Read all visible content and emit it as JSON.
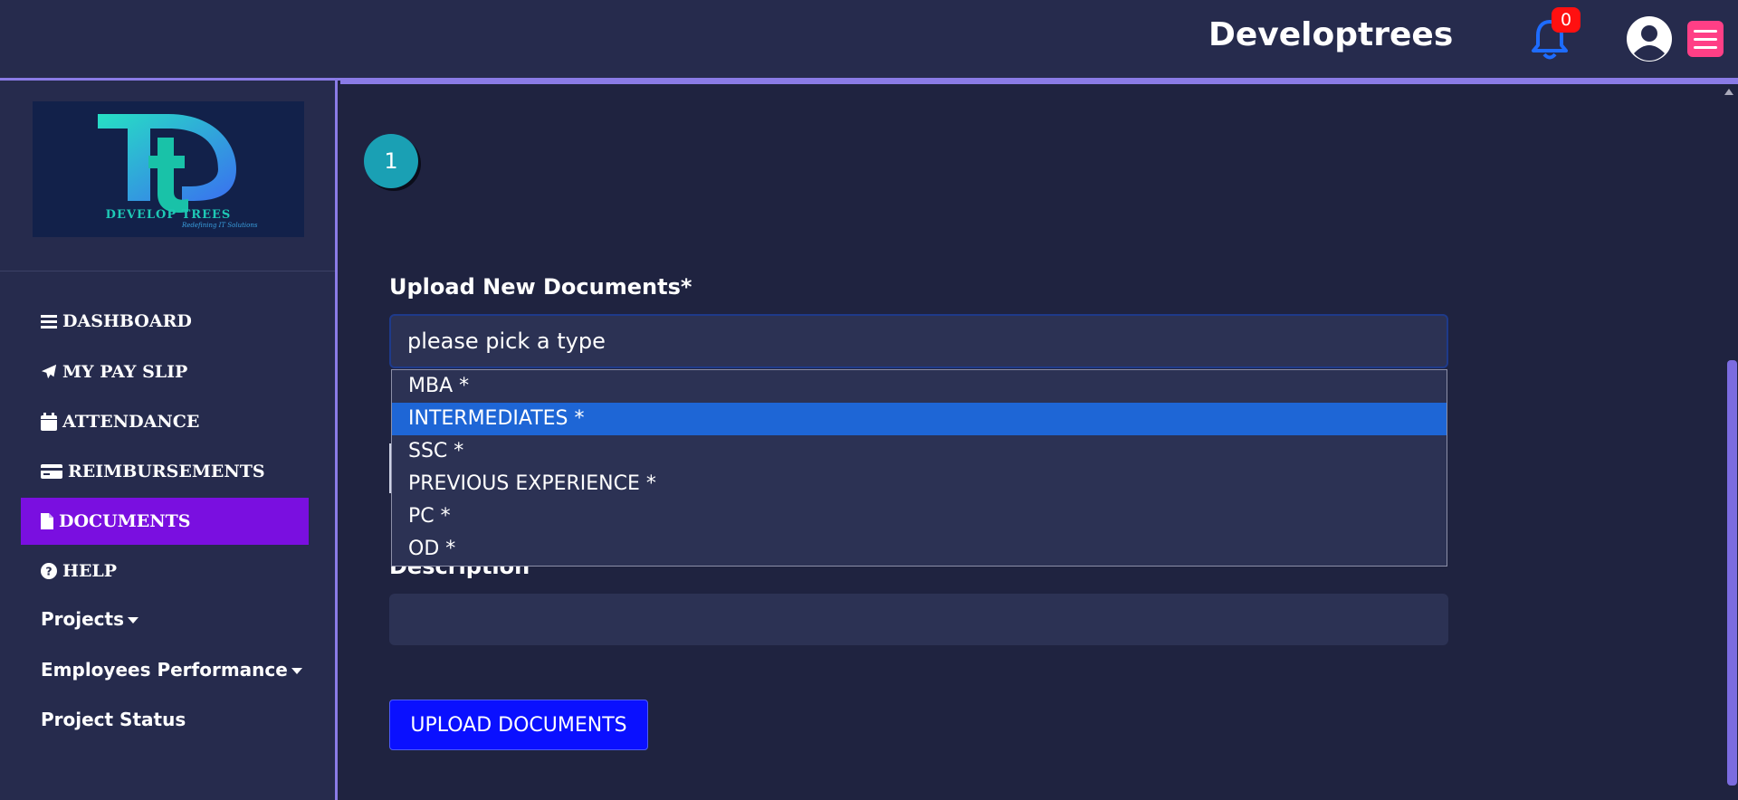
{
  "header": {
    "app_title": "Developtrees",
    "notification_count": "0",
    "bell_icon": "bell-icon",
    "user_icon": "user-circle-icon",
    "menu_icon": "hamburger-menu-icon",
    "accent_color": "#8a7be6",
    "menu_button_color": "#ff3f86"
  },
  "sidebar": {
    "logo": {
      "company": "DEVELOP TREES",
      "tagline": "Redefining IT Solutions",
      "monogram": "Dt"
    },
    "items": [
      {
        "label": "DASHBOARD",
        "icon": "bars-icon",
        "active": false
      },
      {
        "label": "MY PAY SLIP",
        "icon": "paper-plane-icon",
        "active": false
      },
      {
        "label": "ATTENDANCE",
        "icon": "calendar-icon",
        "active": false
      },
      {
        "label": "REIMBURSEMENTS",
        "icon": "credit-card-icon",
        "active": false
      },
      {
        "label": "DOCUMENTS",
        "icon": "file-icon",
        "active": true
      },
      {
        "label": "HELP",
        "icon": "question-circle-icon",
        "active": false
      }
    ],
    "dropdown_items": [
      {
        "label": "Projects"
      },
      {
        "label": "Employees Performance"
      }
    ],
    "plain_items": [
      {
        "label": "Project Status"
      }
    ],
    "active_color": "#7a0fe0"
  },
  "main": {
    "step_number": "1",
    "upload_label": "Upload New Documents*",
    "select_value": "please pick a type",
    "options": [
      {
        "label": "MBA *",
        "selected": false
      },
      {
        "label": "INTERMEDIATES *",
        "selected": true
      },
      {
        "label": "SSC *",
        "selected": false
      },
      {
        "label": "PREVIOUS EXPERIENCE *",
        "selected": false
      },
      {
        "label": "PC *",
        "selected": false
      },
      {
        "label": "OD *",
        "selected": false
      }
    ],
    "description_label": "Description",
    "description_value": "",
    "upload_button": "UPLOAD DOCUMENTS",
    "selected_option_color": "#1e66d6",
    "button_color": "#0a10ff"
  }
}
